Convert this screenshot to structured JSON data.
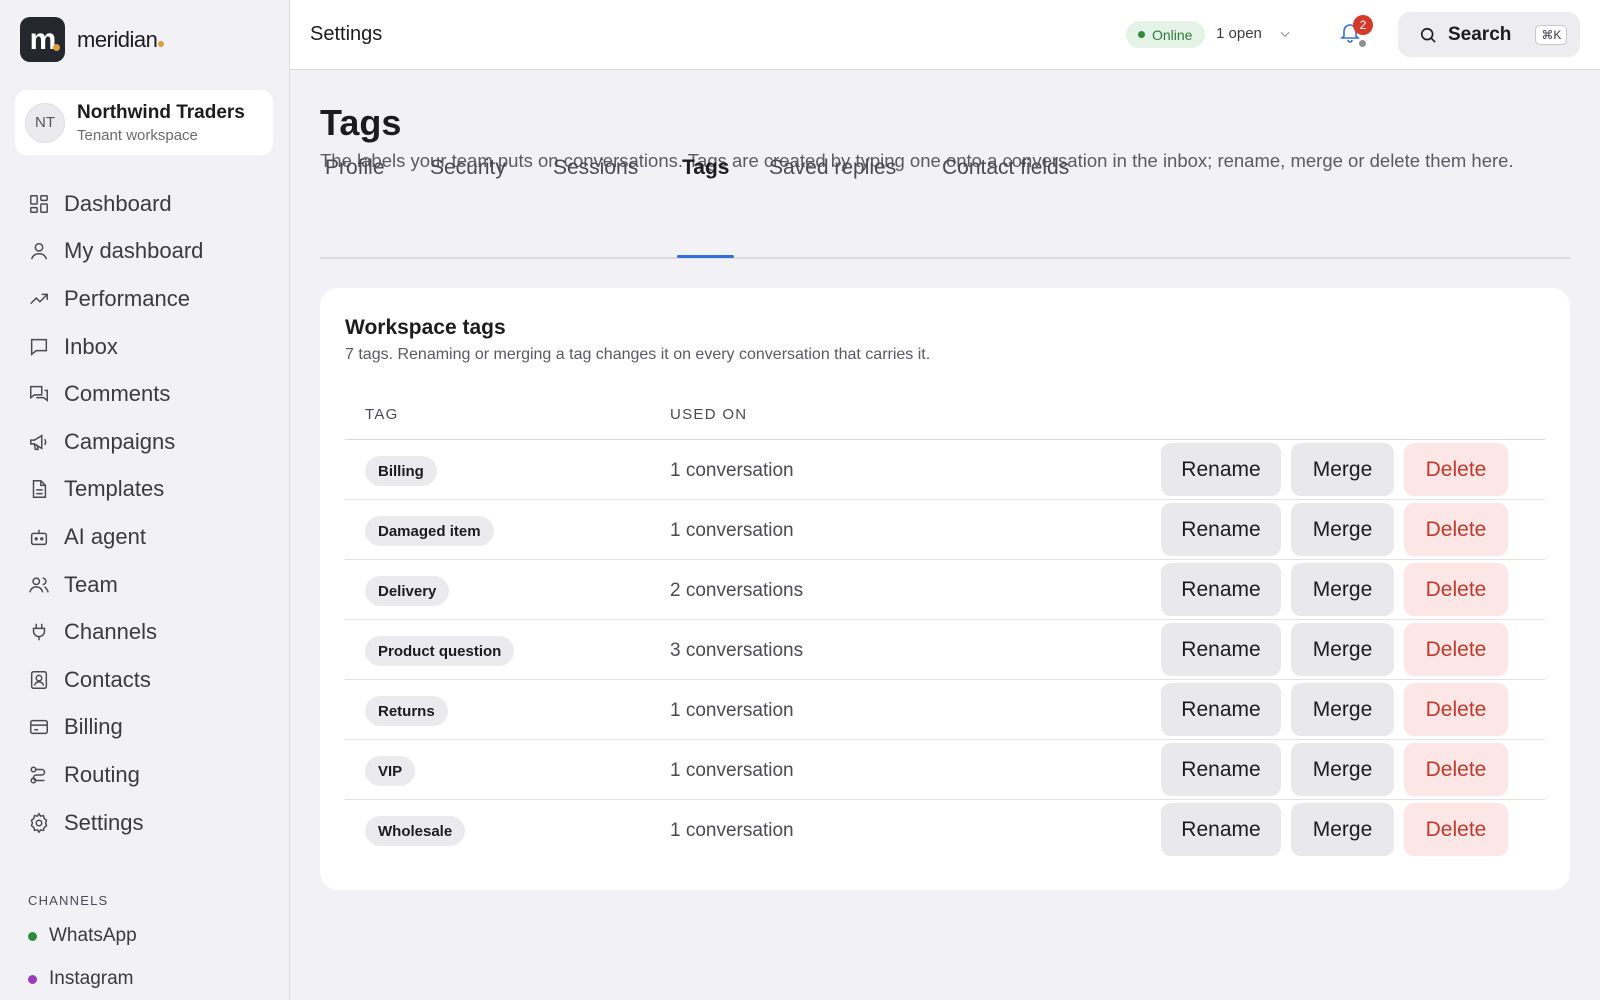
{
  "brand": {
    "logo_letter": "m",
    "name": "meridian"
  },
  "tenant": {
    "initials": "NT",
    "name": "Northwind Traders",
    "subtitle": "Tenant workspace"
  },
  "nav": [
    {
      "label": "Dashboard",
      "icon": "grid-icon"
    },
    {
      "label": "My dashboard",
      "icon": "user-icon"
    },
    {
      "label": "Performance",
      "icon": "trend-icon"
    },
    {
      "label": "Inbox",
      "icon": "chat-icon"
    },
    {
      "label": "Comments",
      "icon": "comments-icon"
    },
    {
      "label": "Campaigns",
      "icon": "megaphone-icon"
    },
    {
      "label": "Templates",
      "icon": "document-icon"
    },
    {
      "label": "AI agent",
      "icon": "robot-icon"
    },
    {
      "label": "Team",
      "icon": "team-icon"
    },
    {
      "label": "Channels",
      "icon": "plug-icon"
    },
    {
      "label": "Contacts",
      "icon": "contact-card-icon"
    },
    {
      "label": "Billing",
      "icon": "credit-card-icon"
    },
    {
      "label": "Routing",
      "icon": "routing-icon"
    },
    {
      "label": "Settings",
      "icon": "gear-icon"
    }
  ],
  "channels": {
    "title": "CHANNELS",
    "items": [
      {
        "label": "WhatsApp",
        "color": "#2f8a3e"
      },
      {
        "label": "Instagram",
        "color": "#9b3dbb"
      }
    ]
  },
  "topbar": {
    "title": "Settings",
    "status": "Online",
    "open_count": "1 open",
    "notifications": "2",
    "search_label": "Search",
    "search_shortcut": "⌘K"
  },
  "page": {
    "title": "Tags",
    "description": "The labels your team puts on conversations. Tags are created by typing one onto a conversation in the inbox; rename, merge or delete them here."
  },
  "tabs": [
    {
      "label": "Profile"
    },
    {
      "label": "Security"
    },
    {
      "label": "Sessions"
    },
    {
      "label": "Tags",
      "active": true
    },
    {
      "label": "Saved replies"
    },
    {
      "label": "Contact fields"
    }
  ],
  "card": {
    "title": "Workspace tags",
    "subtitle": "7 tags. Renaming or merging a tag changes it on every conversation that carries it.",
    "columns": {
      "tag": "TAG",
      "used_on": "USED ON"
    },
    "actions": {
      "rename": "Rename",
      "merge": "Merge",
      "delete": "Delete"
    },
    "rows": [
      {
        "tag": "Billing",
        "used_on": "1 conversation"
      },
      {
        "tag": "Damaged item",
        "used_on": "1 conversation"
      },
      {
        "tag": "Delivery",
        "used_on": "2 conversations"
      },
      {
        "tag": "Product question",
        "used_on": "3 conversations"
      },
      {
        "tag": "Returns",
        "used_on": "1 conversation"
      },
      {
        "tag": "VIP",
        "used_on": "1 conversation"
      },
      {
        "tag": "Wholesale",
        "used_on": "1 conversation"
      }
    ]
  },
  "colors": {
    "accent": "#2f6fd6",
    "danger": "#c0392b",
    "online": "#2f8a3e",
    "brand_dot": "#e39b3a"
  }
}
